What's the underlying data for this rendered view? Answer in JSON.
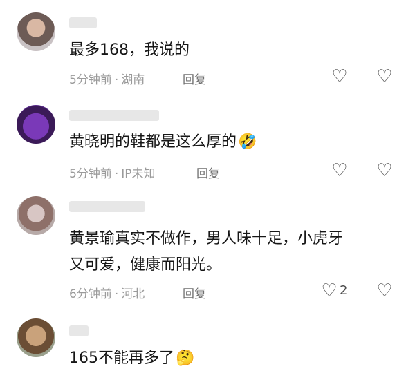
{
  "comments": [
    {
      "text": "最多168，我说的",
      "time": "5分钟前",
      "location": "湖南",
      "reply_label": "回复",
      "like_count": ""
    },
    {
      "text": "黄晓明的鞋都是这么厚的",
      "emoji": "🤣",
      "time": "5分钟前",
      "location": "IP未知",
      "reply_label": "回复",
      "like_count": ""
    },
    {
      "text_line1": "黄景瑜真实不做作，男人味十足，小虎牙",
      "text_line2": "又可爱，健康而阳光。",
      "time": "6分钟前",
      "location": "河北",
      "reply_label": "回复",
      "like_count": "2"
    },
    {
      "text": "165不能再多了",
      "emoji": "🤔"
    }
  ],
  "meta_separator": "·",
  "icons": {
    "like": "heart-outline-icon",
    "dislike": "broken-heart-outline-icon"
  }
}
